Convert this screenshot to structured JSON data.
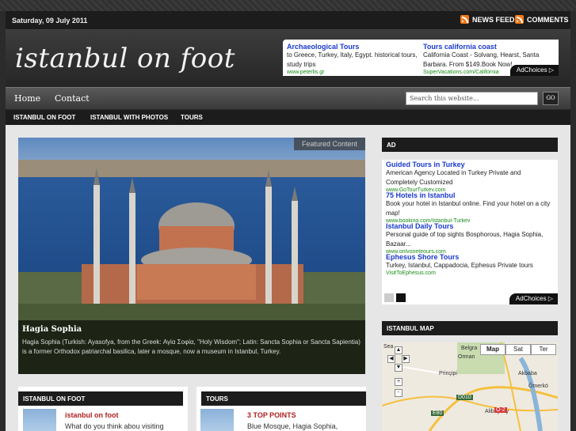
{
  "topbar": {
    "date": "Saturday, 09 July 2011",
    "news_feed": "NEWS FEED",
    "comments": "COMMENTS"
  },
  "header": {
    "logo": "istanbul on foot",
    "ad": {
      "items": [
        {
          "title": "Archaeological Tours",
          "text": "to Greece, Turkey, Italy, Egypt. historical tours, study trips",
          "url": "www.peterlis.gr"
        },
        {
          "title": "Tours california coast",
          "text": "California Coast - Solvang, Hearst, Santa Barbara. From $149.Book Now!",
          "url": "SuperVacations.com/California"
        }
      ],
      "adchoices": "AdChoices"
    }
  },
  "nav": {
    "items": [
      "Home",
      "Contact"
    ],
    "search_placeholder": "Search this website...",
    "go_label": "GO"
  },
  "subnav": {
    "items": [
      "ISTANBUL ON FOOT",
      "ISTANBUL WITH PHOTOS",
      "TOURS"
    ]
  },
  "featured": {
    "tag": "Featured Content",
    "title": "Hagia Sophia",
    "text": "Hagia Sophia (Turkish: Ayasofya, from the Greek: Αγία Σοφία, \"Holy Wisdom\"; Latin: Sancta Sophia or Sancta Sapientia) is a former Orthodox patriarchal basilica, later a mosque, now a museum in Istanbul, Turkey."
  },
  "sidebar": {
    "ad_heading": "AD",
    "ads": [
      {
        "title": "Guided Tours in Turkey",
        "text": "American Agency Located in Turkey Private and Completely Customized",
        "url": "www.GoTourTurkey.com"
      },
      {
        "title": "75 Hotels in Istanbul",
        "text": "Book your hotel in Istanbul online. Find your hotel on a city map!",
        "url": "www.booking.com/Istanbul-Turkey"
      },
      {
        "title": "Istanbul Daily Tours",
        "text": "Personal guide of top sights Bosphorous, Hagia Sophia, Bazaar...",
        "url": "www.onlyoneteours.com"
      },
      {
        "title": "Ephesus Shore Tours",
        "text": "Turkey, Istanbul, Cappadocia, Ephesus Private tours",
        "url": "VisitToEphesus.com"
      }
    ],
    "adchoices": "AdChoices",
    "map_heading": "ISTANBUL MAP",
    "map_tabs": [
      "Map",
      "Sat",
      "Ter"
    ],
    "map_labels": [
      "Belgra",
      "Orman",
      "Prinçipi",
      "Akbaba",
      "Ömerkö",
      "Alibeyköy",
      "Sea"
    ],
    "map_shields": [
      "D010",
      "E80",
      "O-2"
    ]
  },
  "bottom": {
    "left_heading": "ISTANBUL ON FOOT",
    "left_title": "istanbul on foot",
    "left_text": "What do you think abou visiting",
    "right_heading": "TOURS",
    "right_title": "3 TOP POINTS",
    "right_text": "Blue Mosque, Hagia Sophia,"
  },
  "colors": {
    "background": "#2b2b2b",
    "content": "#e6e6e6",
    "ad_link": "#1a3acc",
    "ad_url": "#1a8a1a",
    "post_title": "#b02020",
    "rss": "#f07a1c"
  }
}
